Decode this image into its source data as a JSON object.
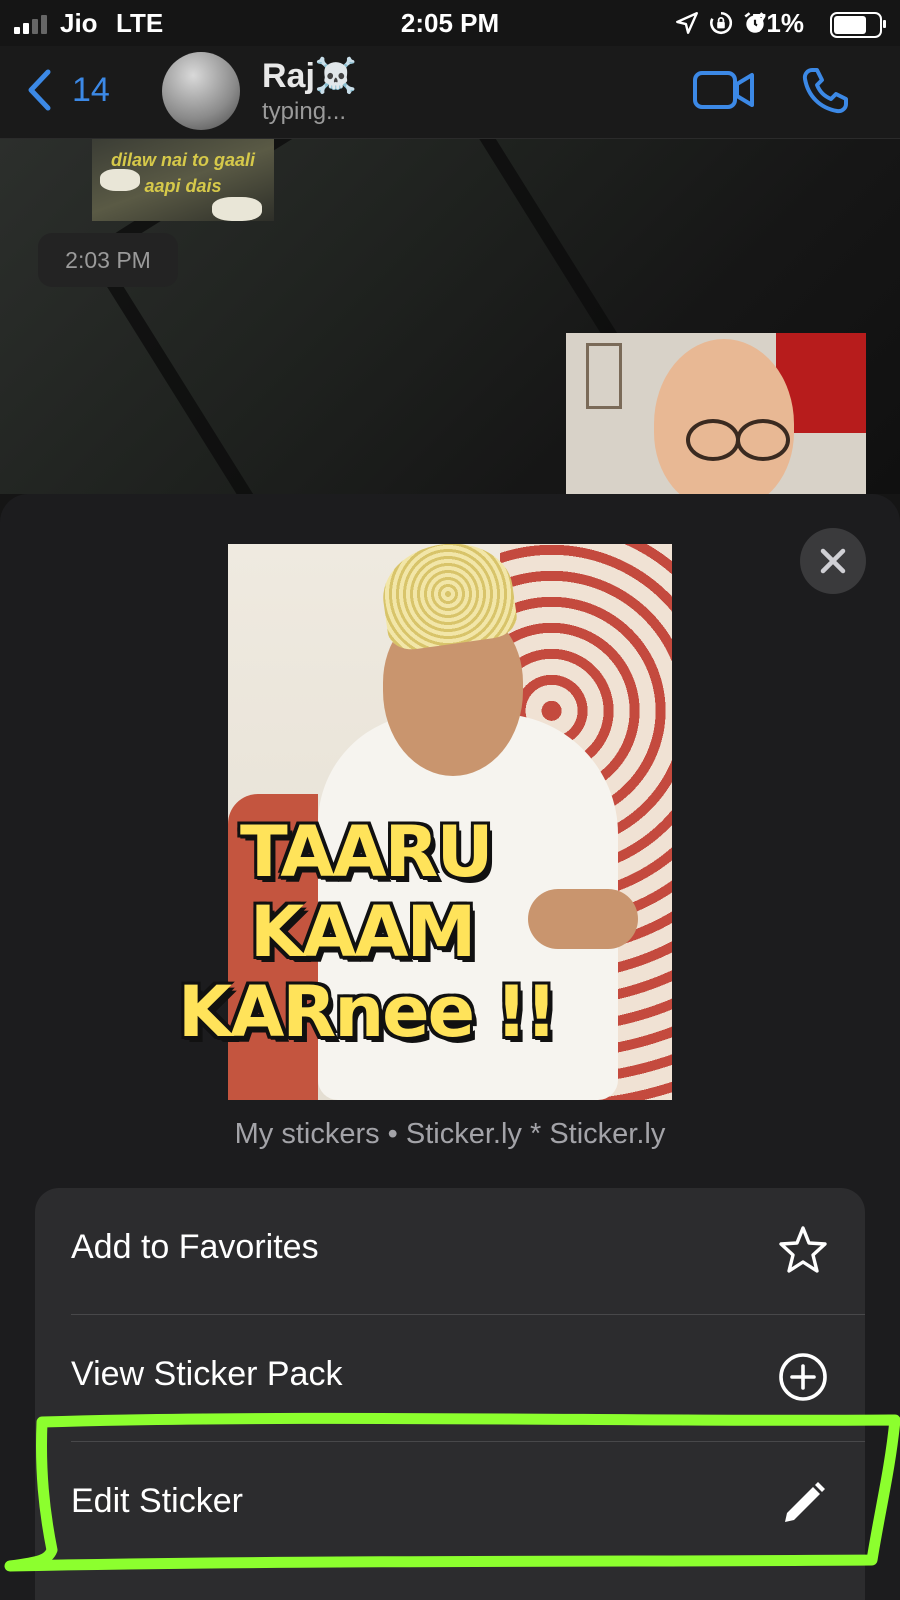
{
  "status_bar": {
    "carrier": "Jio",
    "network": "LTE",
    "time": "2:05 PM",
    "battery": "71%",
    "icons": [
      "signal-icon",
      "location-icon",
      "rotation-lock-icon",
      "alarm-icon",
      "battery-icon"
    ]
  },
  "nav": {
    "back_count": "14",
    "contact_name": "Raj☠️",
    "contact_status": "typing...",
    "icons": [
      "chevron-left-icon",
      "video-call-icon",
      "phone-icon"
    ]
  },
  "chat": {
    "top_sticker_text": "dilaw nai to gaali aapi dais",
    "timestamp": "2:03 PM"
  },
  "sheet": {
    "sticker_text": [
      "TAARU",
      "KAAM",
      "KARnee !!"
    ],
    "sticker_source": "My stickers • Sticker.ly * Sticker.ly",
    "menu": [
      {
        "label": "Add to Favorites",
        "icon": "star-icon"
      },
      {
        "label": "View Sticker Pack",
        "icon": "plus-circle-icon"
      },
      {
        "label": "Edit Sticker",
        "icon": "pencil-icon"
      }
    ]
  },
  "colors": {
    "accent": "#3c89e6",
    "highlight": "#8cff2e",
    "sheet_bg": "#1c1c1e",
    "menu_bg": "#2c2c2e"
  }
}
